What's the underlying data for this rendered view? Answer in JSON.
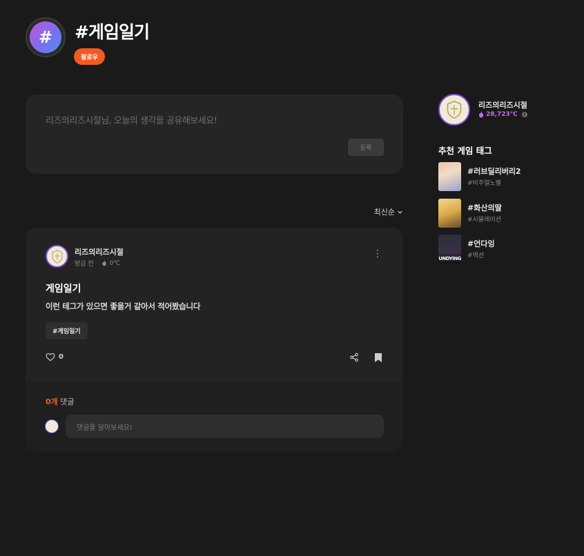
{
  "header": {
    "hash_symbol": "#",
    "tag_title": "#게임일기",
    "follow_label": "팔로우"
  },
  "composer": {
    "placeholder": "리즈의리즈시절님, 오늘의 생각을 공유해보세요!",
    "submit_label": "등록"
  },
  "sort": {
    "label": "최신순"
  },
  "post": {
    "author": "리즈의리즈시절",
    "time": "방금 전",
    "temperature": "0℃",
    "title": "게임일기",
    "body": "이런 테그가 있으면 좋을거 같아서 적어봤습니다",
    "tag_chip": "#게임일기",
    "like_count": "0"
  },
  "comments": {
    "count": "0개",
    "count_suffix": "댓글",
    "input_placeholder": "댓글을 달아보세요!"
  },
  "sidebar": {
    "profile": {
      "name": "리즈의리즈시절",
      "temperature": "28,723℃"
    },
    "rec_heading": "추천 게임 태그",
    "rec_items": [
      {
        "tag": "#러브딜리버리2",
        "genre": "#비주얼노벨"
      },
      {
        "tag": "#화산의딸",
        "genre": "#시뮬레이션"
      },
      {
        "tag": "#언다잉",
        "genre": "#액션",
        "thumb_text": "UNDYING"
      }
    ]
  },
  "colors": {
    "background": "#1a1a1a",
    "card": "#232323",
    "accent_orange": "#f25a22",
    "accent_purple": "#c06cf0"
  }
}
